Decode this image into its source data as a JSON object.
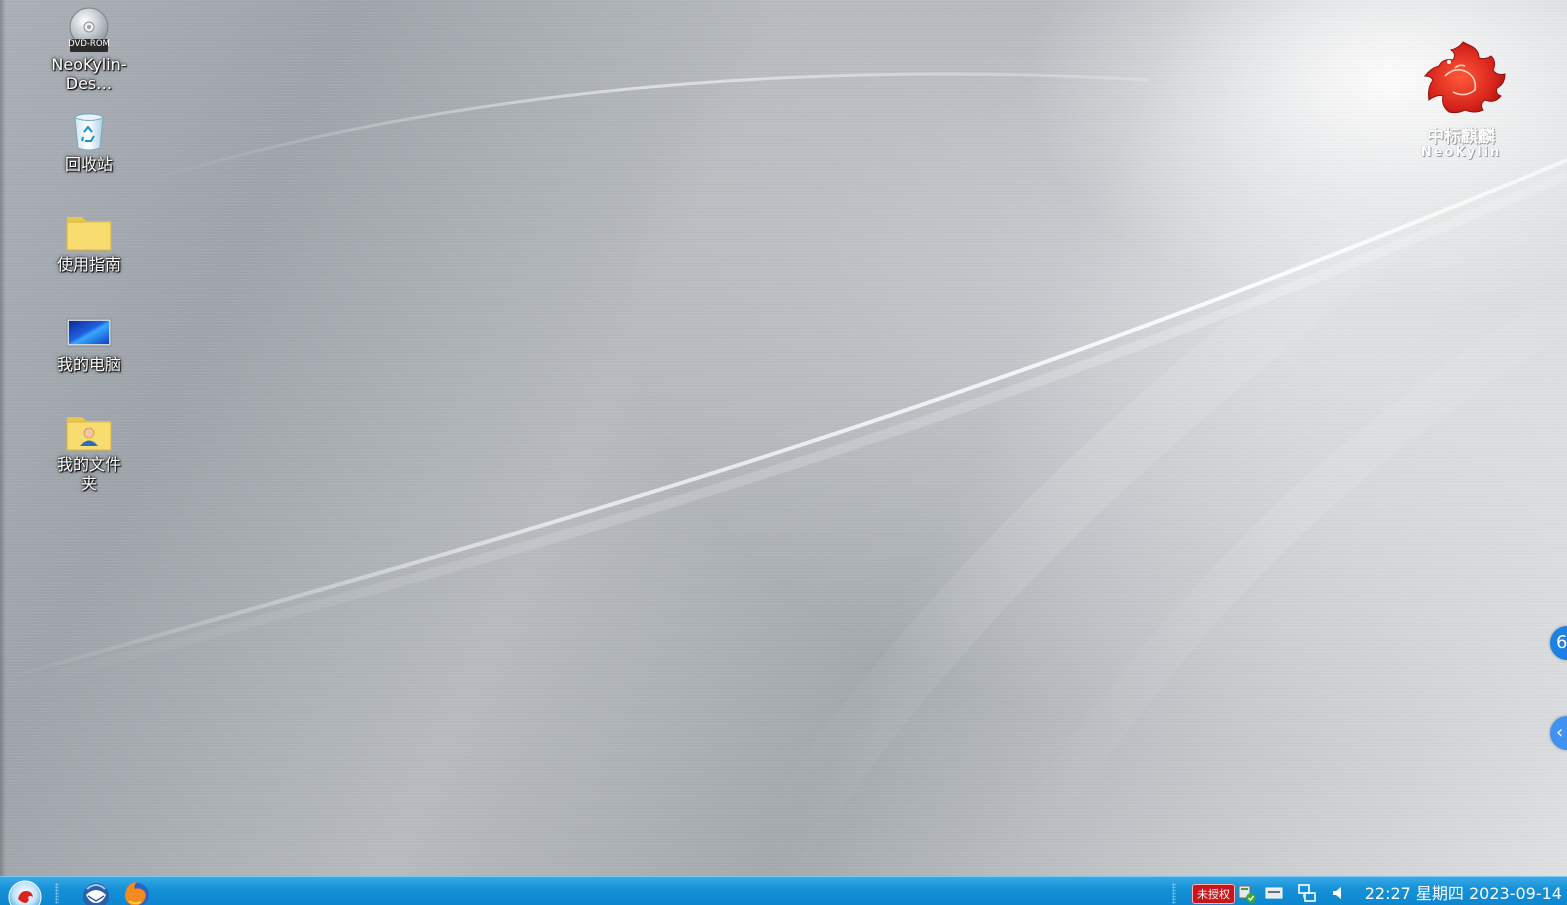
{
  "desktop": {
    "icons": [
      {
        "label": "NeoKylin-Des…",
        "icon": "dvd-rom-icon",
        "disc_text": "DVD-ROM"
      },
      {
        "label": "回收站",
        "icon": "recycle-bin-icon"
      },
      {
        "label": "使用指南",
        "icon": "folder-icon"
      },
      {
        "label": "我的电脑",
        "icon": "computer-icon"
      },
      {
        "label": "我的文件夹",
        "icon": "user-folder-icon"
      }
    ],
    "logo": {
      "cn": "中标麒麟",
      "en": "NeoKylin"
    },
    "edge_tabs": [
      {
        "icon": "assistant-icon",
        "glyph": "6"
      },
      {
        "icon": "chevron-left-icon",
        "glyph": "‹"
      }
    ]
  },
  "taskbar": {
    "start_icon": "kylin-start-icon",
    "launchers": [
      {
        "icon": "thunderbird-icon"
      },
      {
        "icon": "firefox-icon"
      }
    ],
    "tray": {
      "unlicensed_badge": "未授权",
      "icons": [
        "update-status-icon",
        "drive-icon",
        "network-icon",
        "volume-icon"
      ]
    },
    "clock": "22:27 星期四 2023-09-14"
  },
  "colors": {
    "taskbar": "#1692d8",
    "badge_red": "#c8141b",
    "edge_tab_blue": "#1e7fe6",
    "logo_red": "#d8241c"
  }
}
